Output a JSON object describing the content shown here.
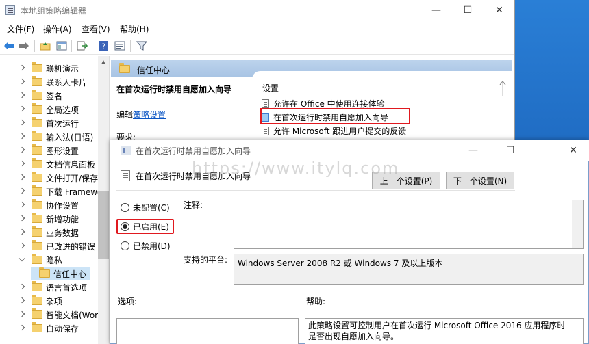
{
  "window": {
    "title": "本地组策略编辑器",
    "controls": {
      "minimize": "—",
      "maximize": "☐",
      "close": "✕"
    }
  },
  "menu": [
    "文件(F)",
    "操作(A)",
    "查看(V)",
    "帮助(H)"
  ],
  "toolbar_icons": [
    "back-arrow-icon",
    "forward-arrow-icon",
    "up-folder-icon",
    "show-hide-tree-icon",
    "export-list-icon",
    "help-icon",
    "properties-icon",
    "filter-icon"
  ],
  "tree": {
    "items": [
      {
        "label": "联机演示",
        "expanded": false
      },
      {
        "label": "联系人卡片",
        "expanded": false
      },
      {
        "label": "签名",
        "expanded": false
      },
      {
        "label": "全局选项",
        "expanded": false
      },
      {
        "label": "首次运行",
        "expanded": false
      },
      {
        "label": "输入法(日语)",
        "expanded": false
      },
      {
        "label": "图形设置",
        "expanded": false
      },
      {
        "label": "文档信息面板",
        "expanded": false
      },
      {
        "label": "文件打开/保存",
        "expanded": false
      },
      {
        "label": "下载 Framewo",
        "expanded": false
      },
      {
        "label": "协作设置",
        "expanded": false
      },
      {
        "label": "新增功能",
        "expanded": false
      },
      {
        "label": "业务数据",
        "expanded": false
      },
      {
        "label": "已改进的错误",
        "expanded": false
      },
      {
        "label": "隐私",
        "expanded": true
      },
      {
        "label": "信任中心",
        "expanded": null,
        "selected": true
      },
      {
        "label": "语言首选项",
        "expanded": false
      },
      {
        "label": "杂项",
        "expanded": false
      },
      {
        "label": "智能文档(Wor",
        "expanded": false
      },
      {
        "label": "自动保存",
        "expanded": false
      }
    ]
  },
  "right_pane": {
    "header": "信任中心",
    "desc_title": "在首次运行时禁用自愿加入向导",
    "edit_prefix": "编辑",
    "edit_link": "策略设置",
    "requirements": "要求:",
    "list_header": "设置",
    "settings": [
      "允许在 Office 中使用连接体验",
      "在首次运行时禁用自愿加入向导",
      "允许 Microsoft 跟进用户提交的反馈"
    ]
  },
  "dialog": {
    "title": "在首次运行时禁用自愿加入向导",
    "setting_name": "在首次运行时禁用自愿加入向导",
    "prev_button": "上一个设置(P)",
    "next_button": "下一个设置(N)",
    "radio_not_configured": "未配置(C)",
    "radio_enabled": "已启用(E)",
    "radio_disabled": "已禁用(D)",
    "selected_state": "已启用(E)",
    "comment_label": "注释:",
    "platform_label": "支持的平台:",
    "platform_value": "Windows Server 2008 R2 或 Windows 7 及以上版本",
    "options_label": "选项:",
    "help_label": "帮助:",
    "help_text": "此策略设置可控制用户在首次运行 Microsoft Office 2016 应用程序时是否出现自愿加入向导。"
  },
  "watermark": "https://www.itylq.com",
  "colors": {
    "header_blue": "#a8c4e4",
    "link_blue": "#0b55c4",
    "highlight_red": "#e0191f",
    "desktop_blue": "#1b64bb"
  }
}
